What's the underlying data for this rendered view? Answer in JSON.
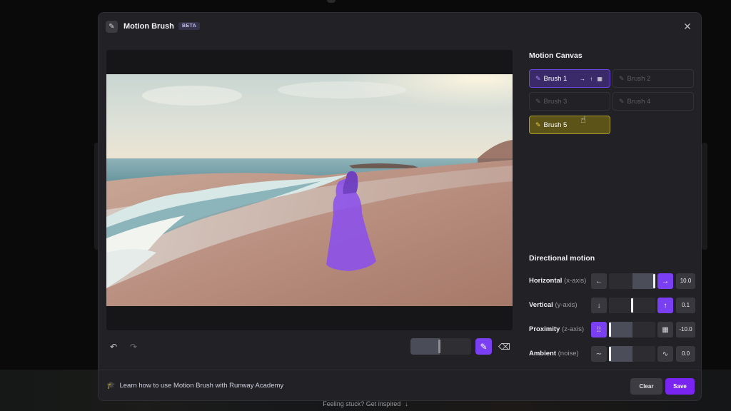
{
  "background_page": {
    "hint_text": "Feeling stuck? Get inspired",
    "hint_icon": "arrow-down-icon"
  },
  "modal": {
    "title": "Motion Brush",
    "badge": "BETA",
    "header_icon": "paintbrush-icon",
    "close_icon": "close-icon"
  },
  "canvas_toolbar": {
    "undo_icon": "undo-icon",
    "redo_icon": "redo-icon",
    "brush_size_fraction": 0.48,
    "paint_tool_icon": "paintbrush-icon",
    "erase_tool_icon": "eraser-icon"
  },
  "motion_canvas": {
    "title": "Motion Canvas",
    "brushes": [
      {
        "label": "Brush 1",
        "state": "active",
        "directions": "→ ↑ ▦"
      },
      {
        "label": "Brush 2",
        "state": "inactive",
        "directions": ""
      },
      {
        "label": "Brush 3",
        "state": "inactive",
        "directions": ""
      },
      {
        "label": "Brush 4",
        "state": "inactive",
        "directions": ""
      },
      {
        "label": "Brush 5",
        "state": "selected",
        "directions": ""
      }
    ]
  },
  "directional_motion": {
    "title": "Directional motion",
    "rows": [
      {
        "label": "Horizontal",
        "axis": "(x-axis)",
        "value": "10.0",
        "left_icon": "←",
        "right_icon": "→",
        "active_side": "right",
        "fraction": 1.0
      },
      {
        "label": "Vertical",
        "axis": "(y-axis)",
        "value": "0.1",
        "left_icon": "↓",
        "right_icon": "↑",
        "active_side": "right",
        "fraction": 0.505
      },
      {
        "label": "Proximity",
        "axis": "(z-axis)",
        "value": "-10.0",
        "left_icon": "⁞⁞",
        "right_icon": "▦",
        "active_side": "left",
        "fraction": 0.0
      },
      {
        "label": "Ambient",
        "axis": "(noise)",
        "value": "0.0",
        "left_icon": "∼",
        "right_icon": "∿",
        "active_side": "none",
        "fraction": 0.0
      }
    ]
  },
  "footer": {
    "academy_link": "Learn how to use Motion Brush with Runway Academy",
    "academy_icon": "graduation-cap-icon",
    "clear_label": "Clear",
    "save_label": "Save"
  },
  "colors": {
    "accent": "#7a3ff2",
    "brush1": "#6b46d8",
    "brush5": "#a89c2a"
  }
}
